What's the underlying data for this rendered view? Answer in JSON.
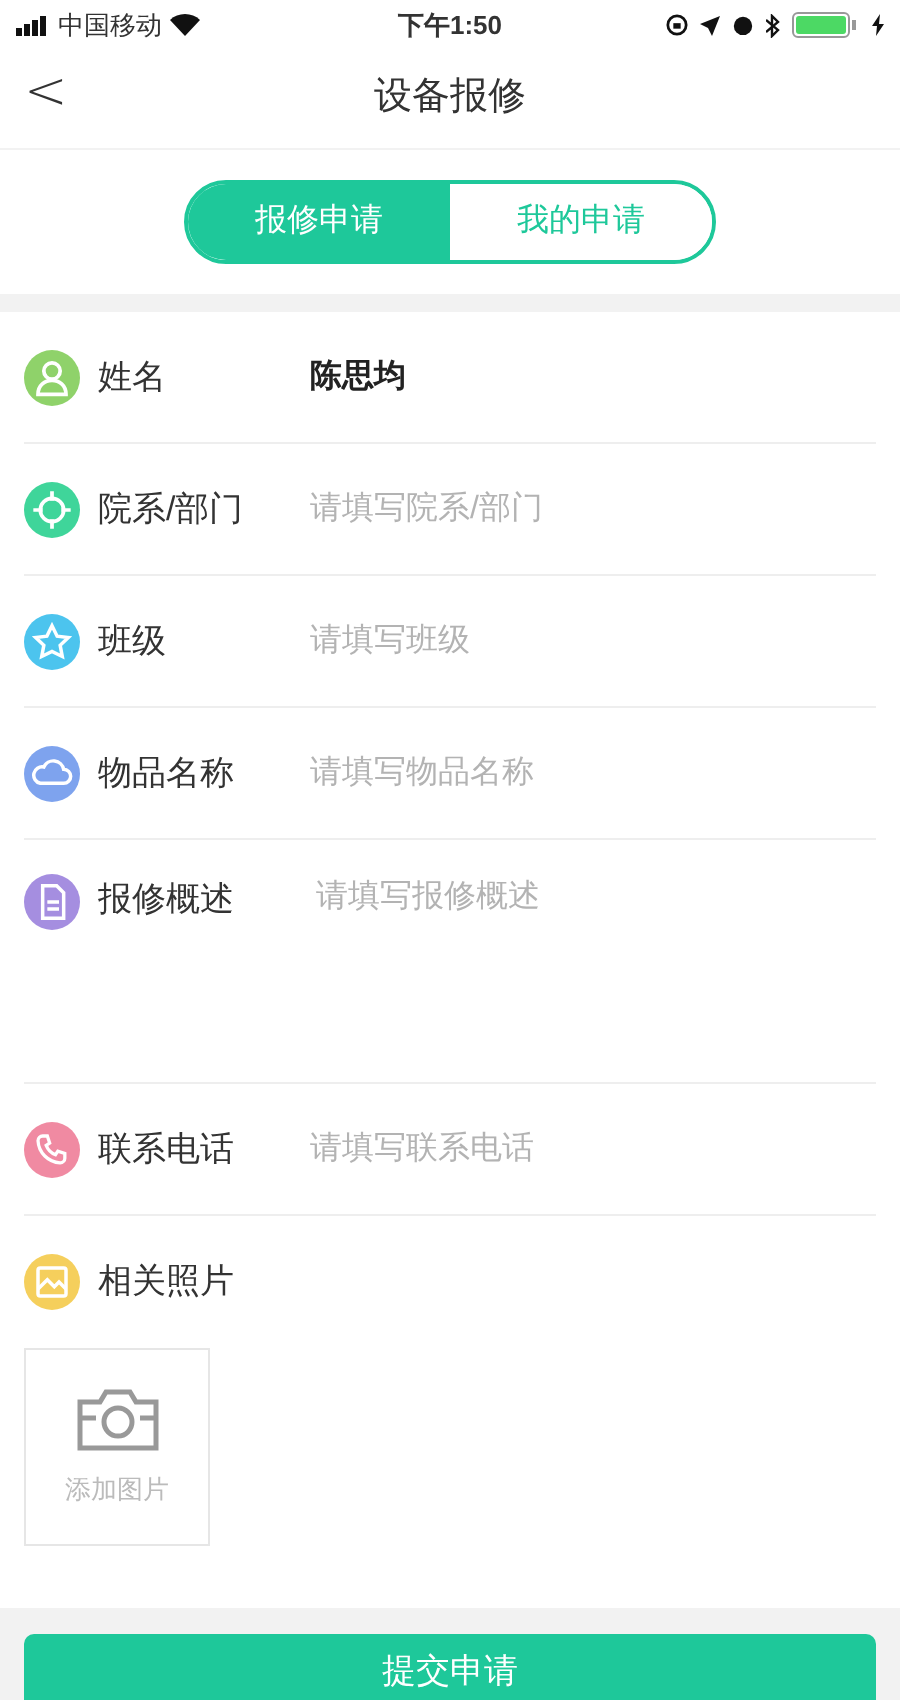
{
  "status_bar": {
    "carrier": "中国移动",
    "time": "下午1:50"
  },
  "nav": {
    "back": "<",
    "title": "设备报修"
  },
  "tabs": [
    {
      "label": "报修申请",
      "selected": true
    },
    {
      "label": "我的申请",
      "selected": false
    }
  ],
  "fields": [
    {
      "kind": "input",
      "label": "姓名",
      "value": "陈思均",
      "color": "#8fd26a"
    },
    {
      "kind": "input",
      "label": "院系/部门",
      "placeholder": "请填写院系/部门",
      "color": "#3fd59a"
    },
    {
      "kind": "input",
      "label": "班级",
      "placeholder": "请填写班级",
      "color": "#4cc4ee"
    },
    {
      "kind": "input",
      "label": "物品名称",
      "placeholder": "请填写物品名称",
      "color": "#7ea3ee"
    },
    {
      "kind": "textarea",
      "label": "报修概述",
      "placeholder": "请填写报修概述",
      "color": "#a58ee0"
    },
    {
      "kind": "input",
      "label": "联系电话",
      "placeholder": "请填写联系电话",
      "color": "#f08aa2"
    }
  ],
  "photos": {
    "label": "相关照片",
    "color": "#f5cf5c",
    "add_label": "添加图片"
  },
  "submit": "提交申请"
}
